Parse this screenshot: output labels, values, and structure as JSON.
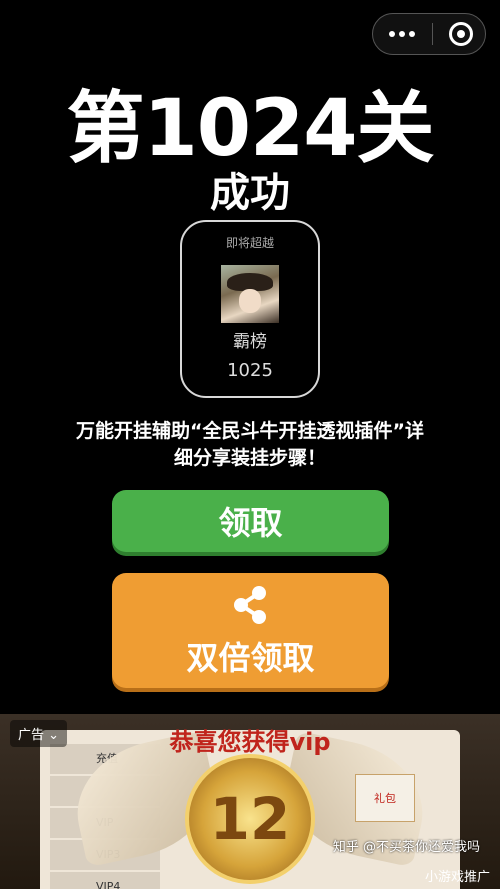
{
  "level": {
    "title": "第1024关",
    "status": "成功"
  },
  "rank_card": {
    "surpass_label": "即将超越",
    "player_name": "霸榜",
    "player_level": "1025"
  },
  "overlay_caption": "万能开挂辅助“全民斗牛开挂透视插件”详细分享装挂步骤！",
  "buttons": {
    "claim_label": "领取",
    "double_claim_label": "双倍领取"
  },
  "ad": {
    "tag_label": "广告",
    "banner_title": "恭喜您获得vip",
    "emblem_number": "12",
    "vip_rows": [
      "充值",
      "",
      "VIP",
      "VIP3",
      "VIP4"
    ],
    "card_label": "礼包",
    "promo_label": "小游戏推广"
  },
  "watermark": "知乎 @不买茶你还爱我吗"
}
